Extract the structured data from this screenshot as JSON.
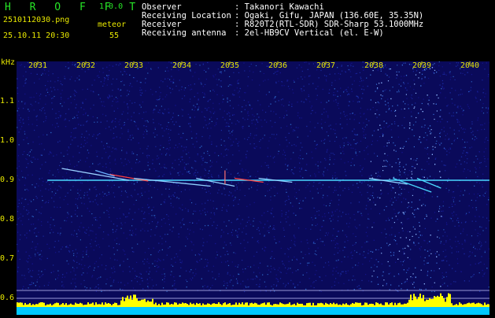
{
  "header": {
    "app_name": "H R O F F T",
    "version": "1.0.0",
    "filename": "2510112030.png",
    "timestamp": "25.10.11 20:30",
    "meteor_label": "meteor",
    "meteor_count": "55",
    "info": [
      {
        "key": "Observer",
        "value": ": Takanori Kawachi"
      },
      {
        "key": "Receiving Location",
        "value": ": Ogaki, Gifu, JAPAN (136.60E, 35.35N)"
      },
      {
        "key": "Receiver",
        "value": ": R820T2(RTL-SDR) SDR-Sharp 53.1000MHz"
      },
      {
        "key": "Receiving antenna",
        "value": ": 2el-HB9CV Vertical (el. E-W)"
      }
    ]
  },
  "chart_data": {
    "type": "heatmap",
    "y_unit": "kHz",
    "y_ticks": [
      "1.1",
      "1.0",
      "0.9",
      "0.8",
      "0.7",
      "0.6"
    ],
    "y_tick_values": [
      1.1,
      1.0,
      0.9,
      0.8,
      0.7,
      0.6
    ],
    "time_ticks": [
      "2031",
      "2032",
      "2033",
      "2034",
      "2035",
      "2036",
      "2037",
      "2038",
      "2039",
      "2040"
    ],
    "time_tick_minutes": [
      1,
      2,
      3,
      4,
      5,
      6,
      7,
      8,
      9,
      10
    ],
    "ylim": [
      0.6,
      1.19
    ],
    "xlim_minutes": [
      0,
      10
    ],
    "carrier_khz": 0.9,
    "colors": {
      "background": "#0a0a5a",
      "carrier": "#4ad8ff",
      "meteor_hot": "#ff4040",
      "labels": "#e8e800",
      "activity": "#ffff00",
      "activity_bg": "#00c8ff"
    }
  }
}
